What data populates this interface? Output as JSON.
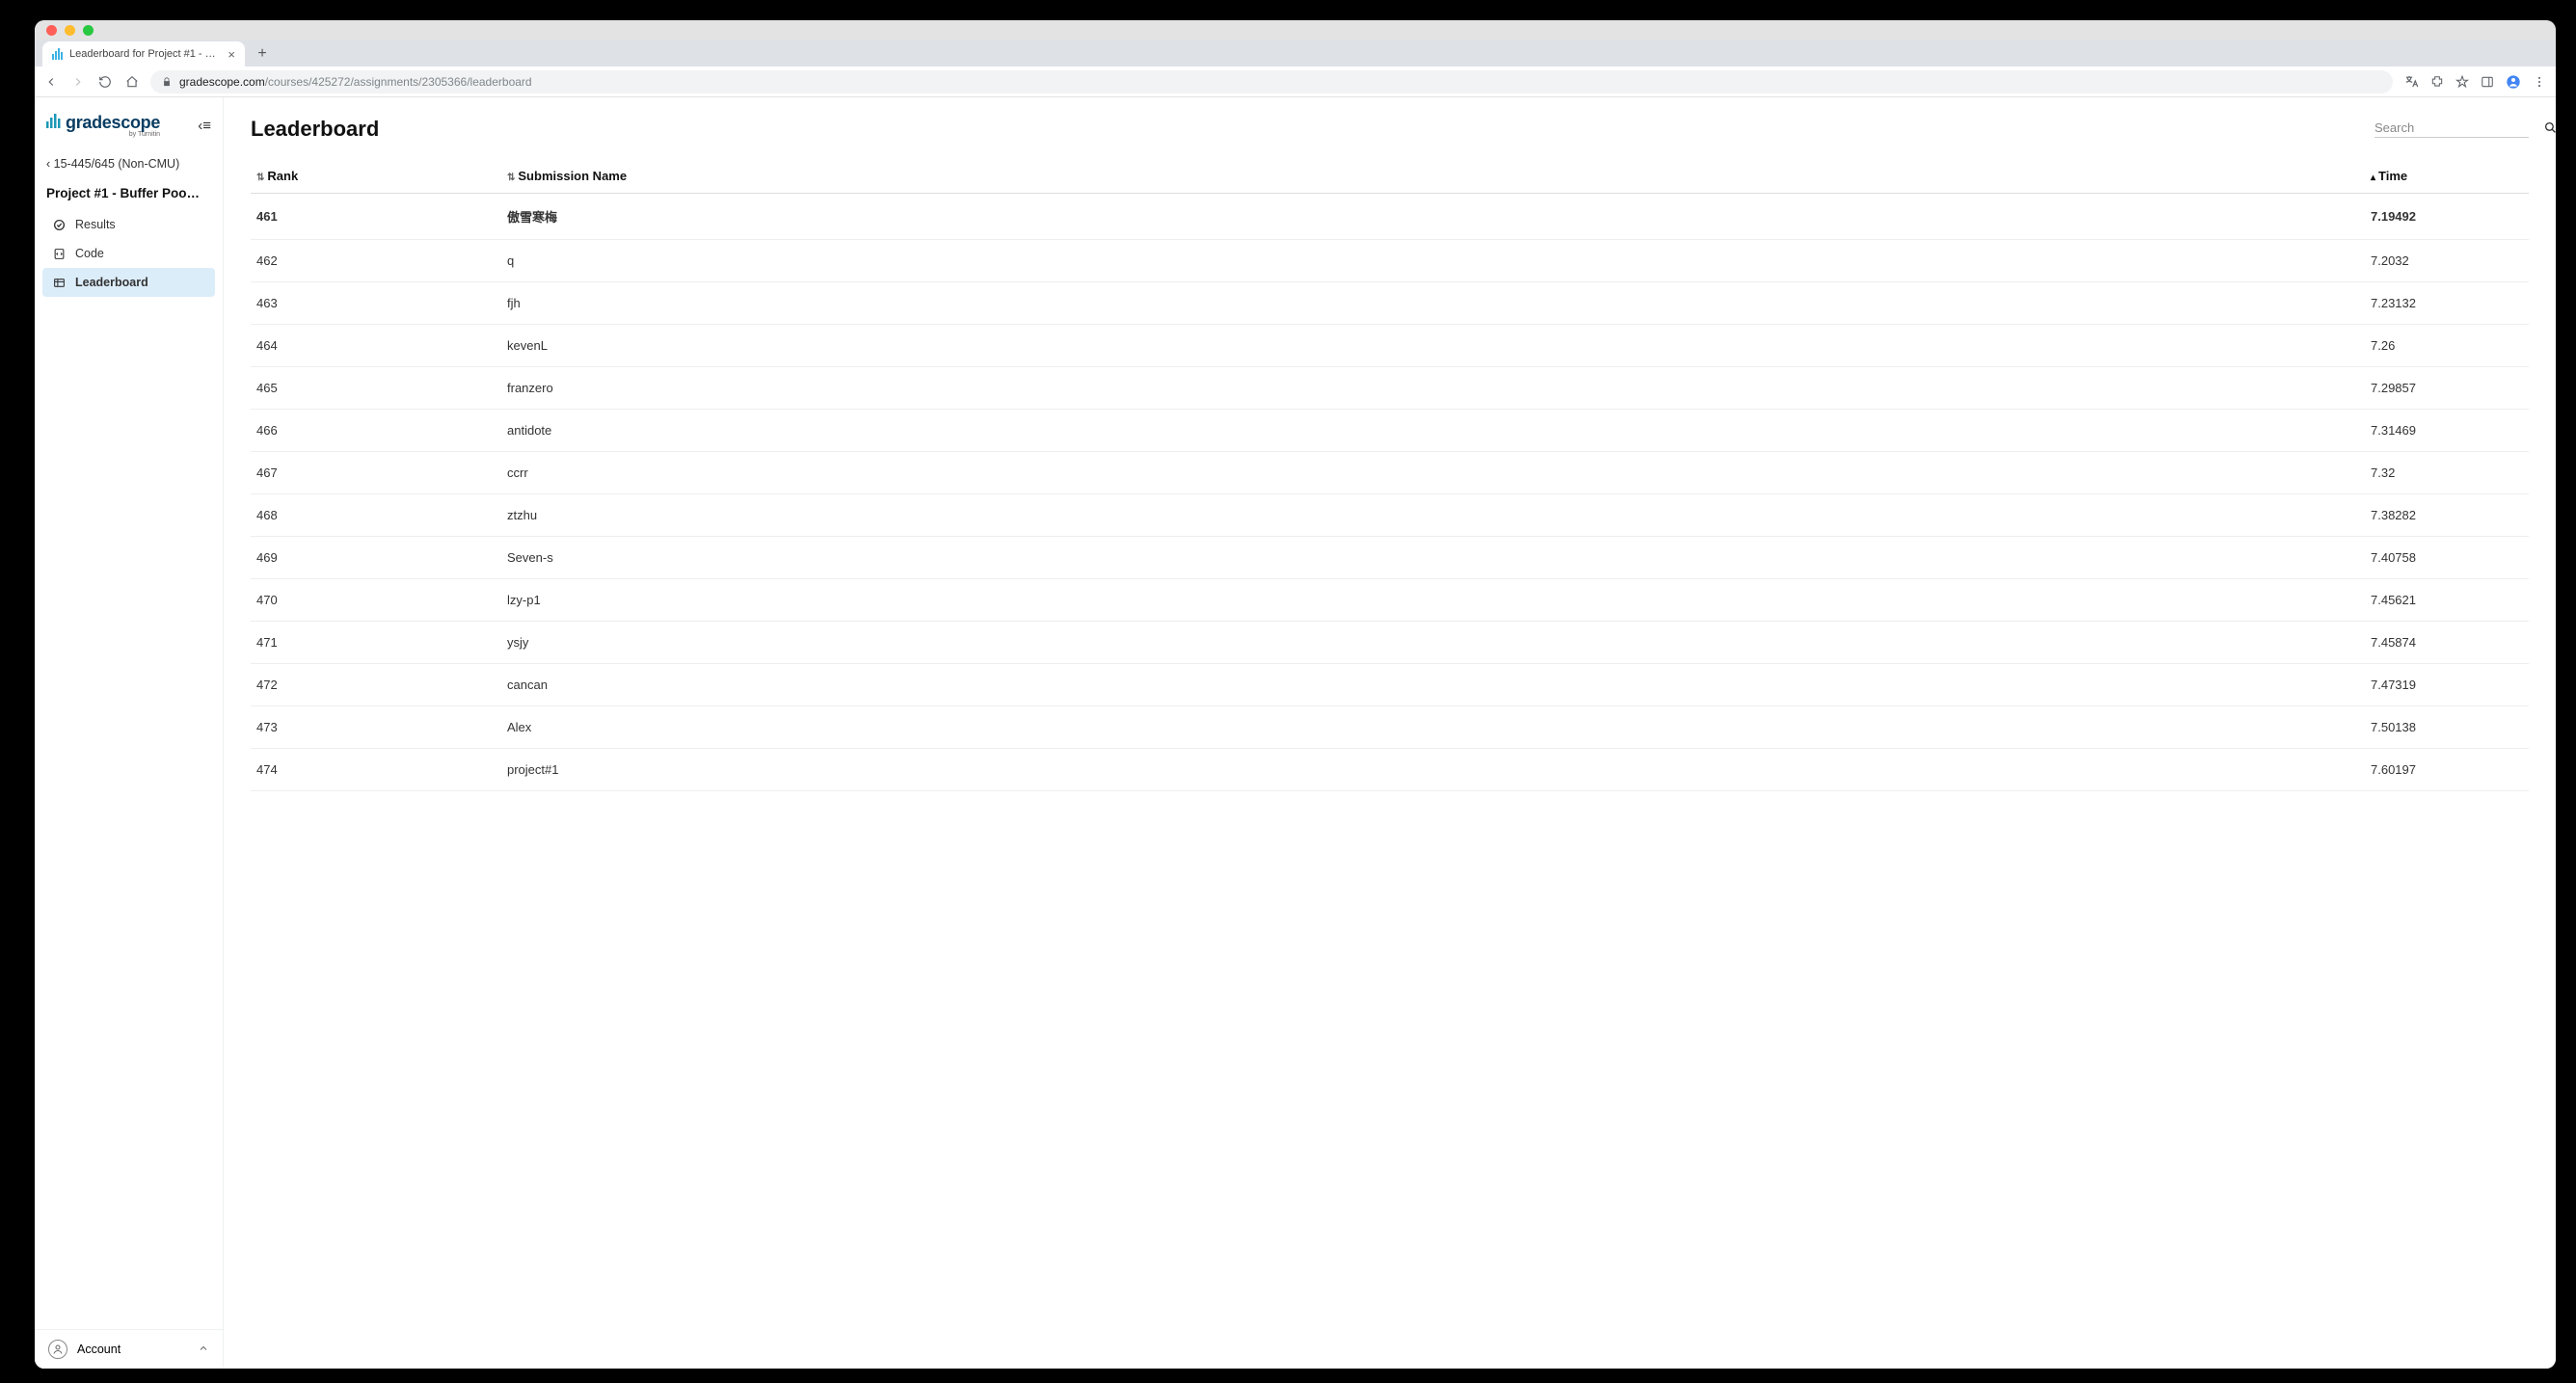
{
  "browser": {
    "tab_title": "Leaderboard for Project #1 - B…",
    "url_domain": "gradescope.com",
    "url_path": "/courses/425272/assignments/2305366/leaderboard"
  },
  "sidebar": {
    "logo_text": "gradescope",
    "logo_byline": "by Turnitin",
    "breadcrumb": "15-445/645 (Non-CMU)",
    "assignment_title": "Project #1 - Buffer Poo…",
    "items": [
      {
        "label": "Results"
      },
      {
        "label": "Code"
      },
      {
        "label": "Leaderboard"
      }
    ],
    "account_label": "Account"
  },
  "main": {
    "page_title": "Leaderboard",
    "search_placeholder": "Search",
    "columns": {
      "rank": "Rank",
      "name": "Submission Name",
      "time": "Time"
    },
    "rows": [
      {
        "rank": "461",
        "name": "傲雪寒梅",
        "time": "7.19492",
        "highlight": true
      },
      {
        "rank": "462",
        "name": "q",
        "time": "7.2032"
      },
      {
        "rank": "463",
        "name": "fjh",
        "time": "7.23132"
      },
      {
        "rank": "464",
        "name": "kevenL",
        "time": "7.26"
      },
      {
        "rank": "465",
        "name": "franzero",
        "time": "7.29857"
      },
      {
        "rank": "466",
        "name": "antidote",
        "time": "7.31469"
      },
      {
        "rank": "467",
        "name": "ccrr",
        "time": "7.32"
      },
      {
        "rank": "468",
        "name": "ztzhu",
        "time": "7.38282"
      },
      {
        "rank": "469",
        "name": "Seven-s",
        "time": "7.40758"
      },
      {
        "rank": "470",
        "name": "lzy-p1",
        "time": "7.45621"
      },
      {
        "rank": "471",
        "name": "ysjy",
        "time": "7.45874"
      },
      {
        "rank": "472",
        "name": "cancan",
        "time": "7.47319"
      },
      {
        "rank": "473",
        "name": "Alex",
        "time": "7.50138"
      },
      {
        "rank": "474",
        "name": "project#1",
        "time": "7.60197"
      }
    ]
  }
}
